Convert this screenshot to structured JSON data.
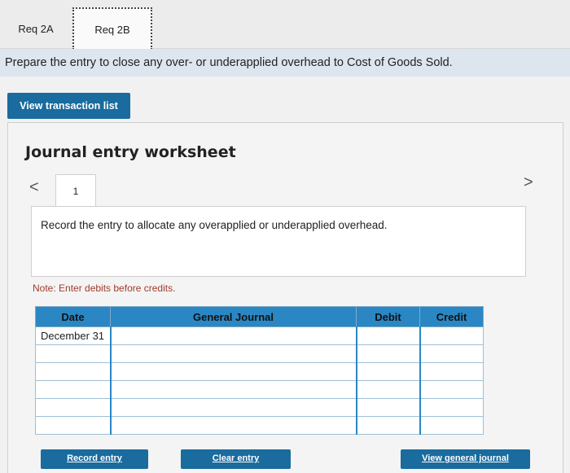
{
  "tabs": [
    {
      "label": "Req 2A"
    },
    {
      "label": "Req 2B"
    }
  ],
  "banner": {
    "text": "Prepare the entry to close any over- or underapplied overhead to Cost of Goods Sold."
  },
  "view_transactions_label": "View transaction list",
  "worksheet": {
    "title": "Journal entry worksheet",
    "nav_prev": "<",
    "nav_next": ">",
    "current_page": "1",
    "instruction": "Record the entry to allocate any overapplied or underapplied overhead.",
    "note": "Note: Enter debits before credits."
  },
  "journal": {
    "headers": {
      "date": "Date",
      "general_journal": "General Journal",
      "debit": "Debit",
      "credit": "Credit"
    },
    "rows": [
      {
        "date": "December 31",
        "account": "",
        "debit": "",
        "credit": ""
      },
      {
        "date": "",
        "account": "",
        "debit": "",
        "credit": ""
      },
      {
        "date": "",
        "account": "",
        "debit": "",
        "credit": ""
      },
      {
        "date": "",
        "account": "",
        "debit": "",
        "credit": ""
      },
      {
        "date": "",
        "account": "",
        "debit": "",
        "credit": ""
      },
      {
        "date": "",
        "account": "",
        "debit": "",
        "credit": ""
      }
    ]
  },
  "buttons": {
    "record": "Record entry",
    "clear": "Clear entry",
    "view_general_journal": "View general journal"
  },
  "colors": {
    "accent": "#1a6b9e",
    "table_header": "#2a87c4",
    "note": "#a33a2a",
    "banner": "#dde6ee"
  }
}
